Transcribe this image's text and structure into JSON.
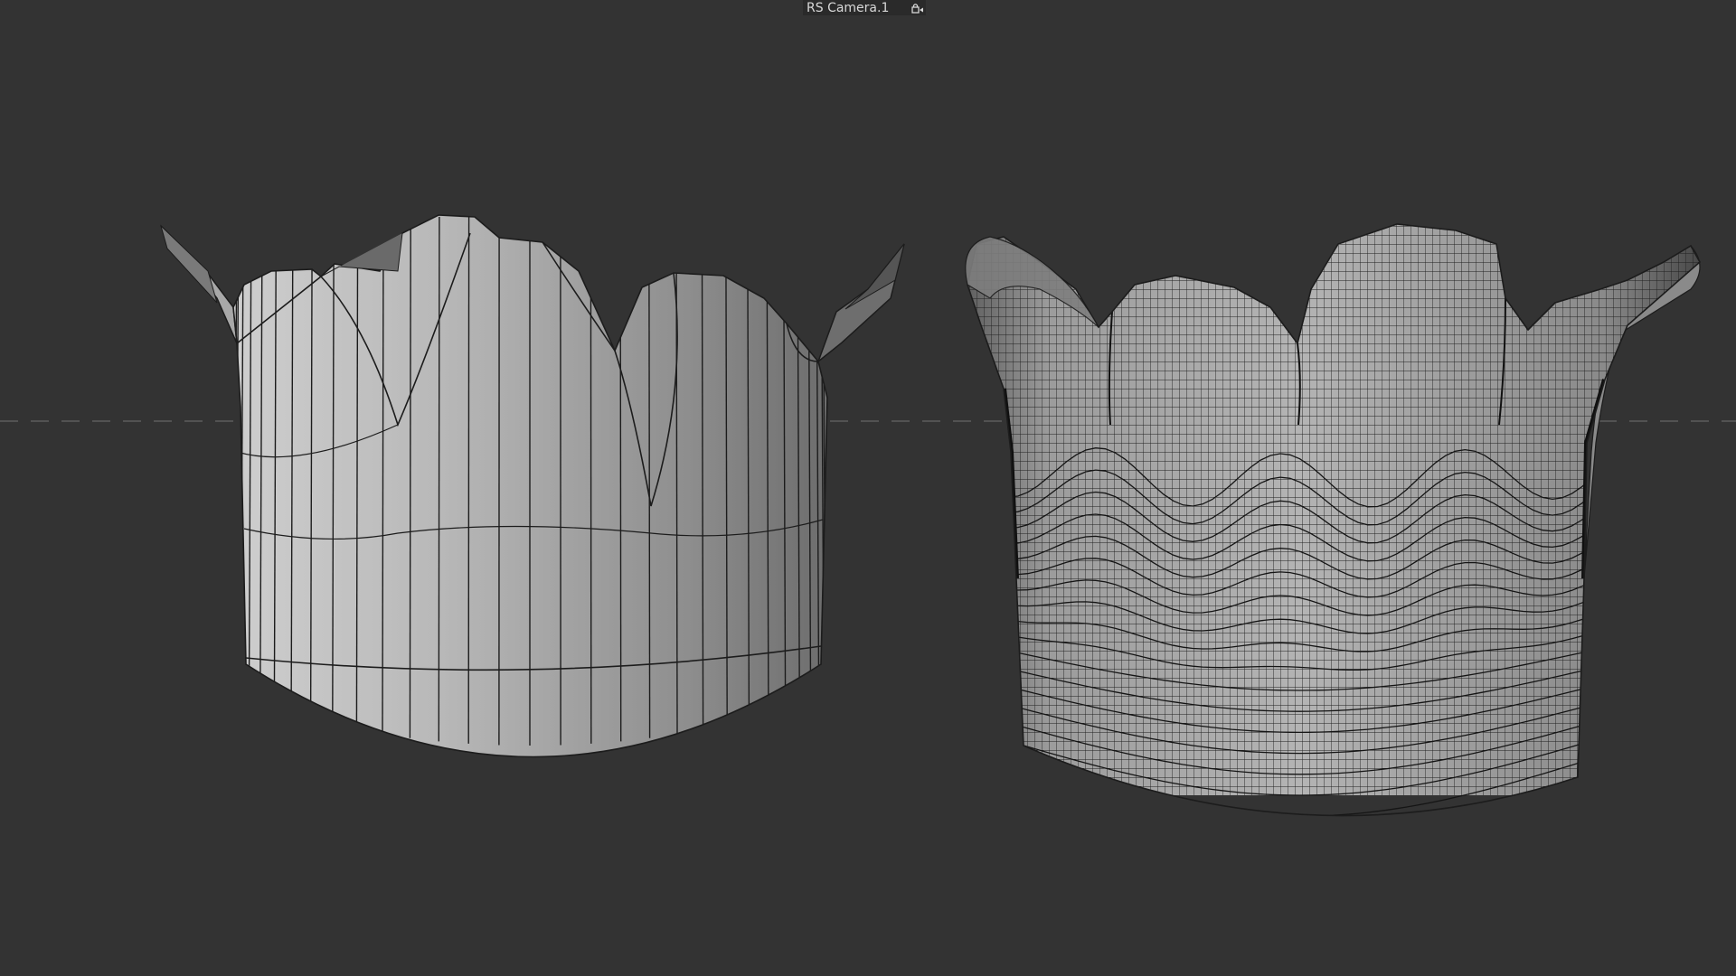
{
  "viewport": {
    "camera_name": "RS Camera.1",
    "camera_lock_icon": "camera-lock-icon",
    "background_color": "#333333",
    "horizon_line_color": "#5c5c5c"
  },
  "objects": [
    {
      "name": "low-poly-crown",
      "surface_color": "#9a9a9a",
      "wire_color": "#1c1c1c"
    },
    {
      "name": "subdivided-crown",
      "surface_color": "#a8a8a8",
      "wire_color": "#1c1c1c"
    }
  ]
}
